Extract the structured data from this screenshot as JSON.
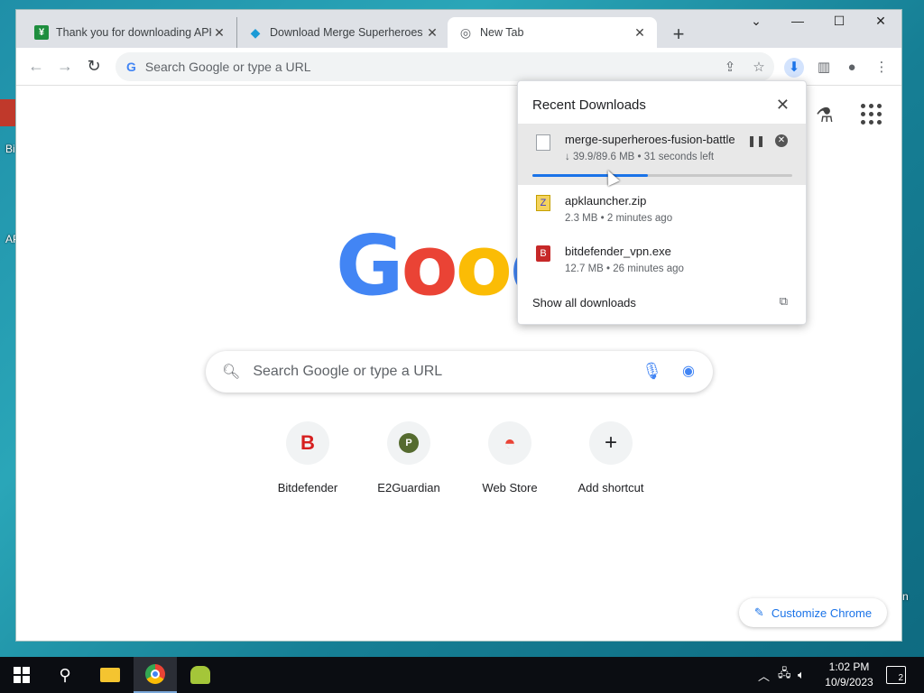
{
  "desktop": {
    "label_a": "Bi",
    "label_b": "AP",
    "label_c": "n"
  },
  "tabs": [
    {
      "title": "Thank you for downloading APK",
      "favicon": "apk-favicon"
    },
    {
      "title": "Download Merge Superheroes F",
      "favicon": "diamond-favicon"
    },
    {
      "title": "New Tab",
      "favicon": "chrome-favicon"
    }
  ],
  "toolbar": {
    "omnibox_placeholder": "Search Google or type a URL"
  },
  "ntp": {
    "logo": [
      "G",
      "o",
      "o",
      "g"
    ],
    "search_placeholder": "Search Google or type a URL",
    "shortcuts": [
      {
        "label": "Bitdefender",
        "glyph": "B",
        "color": "#d61f1f"
      },
      {
        "label": "E2Guardian",
        "glyph": "P",
        "color": "#556b2f"
      },
      {
        "label": "Web Store",
        "glyph": "◓",
        "color": "#ea4335"
      },
      {
        "label": "Add shortcut",
        "glyph": "+",
        "color": "#202124"
      }
    ],
    "customize_label": "Customize Chrome"
  },
  "downloads": {
    "title": "Recent Downloads",
    "items": [
      {
        "name": "merge-superheroes-fusion-battle",
        "meta": "↓ 39.9/89.6 MB • 31 seconds left",
        "progress": 0.445
      },
      {
        "name": "apklauncher.zip",
        "meta": "2.3 MB • 2 minutes ago"
      },
      {
        "name": "bitdefender_vpn.exe",
        "meta": "12.7 MB • 26 minutes ago"
      }
    ],
    "show_all": "Show all downloads"
  },
  "taskbar": {
    "time": "1:02 PM",
    "date": "10/9/2023",
    "notifications": "2"
  }
}
